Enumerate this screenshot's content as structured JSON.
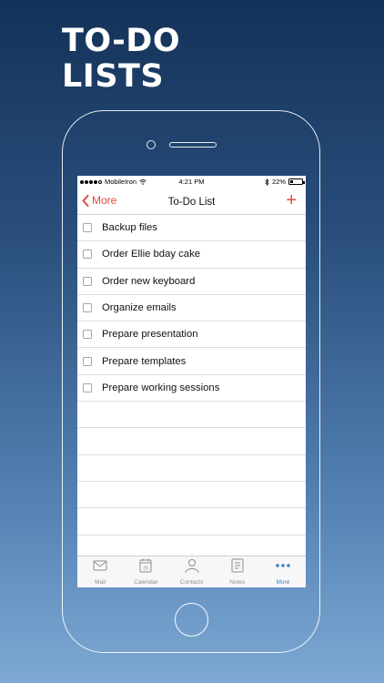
{
  "headline": [
    "TO-DO",
    "LISTS"
  ],
  "status_bar": {
    "carrier": "MobileIron",
    "time": "4:21 PM",
    "battery": "22%"
  },
  "nav": {
    "back_label": "More",
    "title": "To-Do List",
    "add_label": "+"
  },
  "tasks": [
    "Backup files",
    "Order Ellie bday cake",
    "Order new keyboard",
    "Organize emails",
    "Prepare presentation",
    "Prepare templates",
    "Prepare working sessions"
  ],
  "tabs": [
    {
      "label": "Mail",
      "icon": "mail-icon"
    },
    {
      "label": "Calendar",
      "icon": "calendar-icon"
    },
    {
      "label": "Contacts",
      "icon": "contacts-icon"
    },
    {
      "label": "Notes",
      "icon": "notes-icon"
    },
    {
      "label": "More",
      "icon": "more-icon",
      "active": true
    }
  ],
  "calendar_day": "26",
  "colors": {
    "accent": "#e2493d",
    "tab_active": "#3b82c4",
    "tab_inactive": "#8e8e93"
  }
}
